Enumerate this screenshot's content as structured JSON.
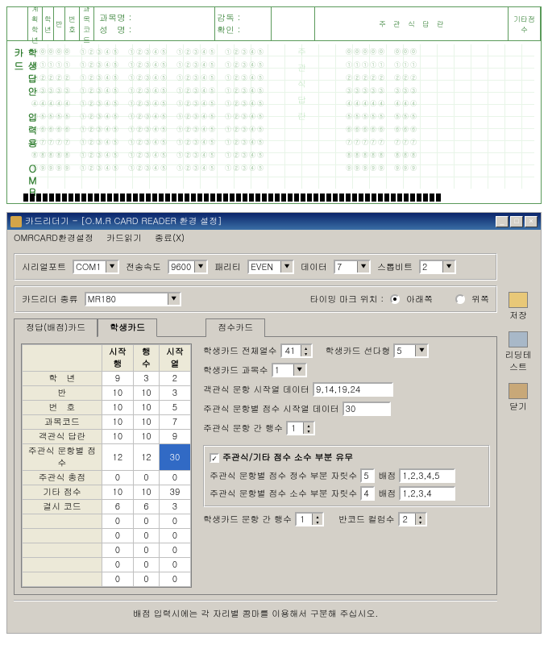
{
  "omr": {
    "side_label": "학생답안　입력용　ＯＭＲ카드",
    "watermark_lines": [
      "주",
      "관",
      "식",
      "답",
      "란"
    ],
    "header_cells": [
      "계획\n학년",
      "학\n년",
      "반",
      "번호",
      "과목\n코드"
    ],
    "header2": {
      "subject": "과목명 :",
      "supervisor": "감독 :",
      "name": "성　명 :",
      "confirm": "확인 :"
    },
    "top_right": "주　관　식　답　란",
    "top_right2": "기타점수"
  },
  "app": {
    "title": "카드리더기 - [O.M.R CARD READER 환경 설정]",
    "menu": [
      "OMRCARD환경설정",
      "카드읽기",
      "종료(X)"
    ],
    "tools": {
      "save": "저장",
      "test": "리딩테스트",
      "close": "닫기"
    },
    "conn": {
      "port_l": "시리얼포트",
      "port": "COM1",
      "baud_l": "전송속도",
      "baud": "9600",
      "parity_l": "패리티",
      "parity": "EVEN",
      "data_l": "데이터",
      "data": "7",
      "stop_l": "스톱비트",
      "stop": "2"
    },
    "reader": {
      "type_l": "카드리더 종류",
      "type": "MR180",
      "timing_l": "타이밍 마크 위치 :",
      "bottom": "아래쪽",
      "top": "위쪽"
    },
    "tabs": {
      "t1": "정답(배점)카드",
      "t2": "학생카드",
      "t3": "점수카드"
    },
    "grid": {
      "cols": [
        "",
        "시작행",
        "행 수",
        "시작열"
      ],
      "rows": [
        [
          "학　년",
          "9",
          "3",
          "2"
        ],
        [
          "반",
          "10",
          "10",
          "3"
        ],
        [
          "번　호",
          "10",
          "10",
          "5"
        ],
        [
          "과목코드",
          "10",
          "10",
          "7"
        ],
        [
          "객관식 답란",
          "10",
          "10",
          "9"
        ],
        [
          "주관식 문항별 점수",
          "12",
          "12",
          "30"
        ],
        [
          "주관식 총점",
          "0",
          "0",
          "0"
        ],
        [
          "기타 점수",
          "10",
          "10",
          "39"
        ],
        [
          "결시 코드",
          "6",
          "6",
          "3"
        ],
        [
          "",
          "0",
          "0",
          "0"
        ],
        [
          "",
          "0",
          "0",
          "0"
        ],
        [
          "",
          "0",
          "0",
          "0"
        ],
        [
          "",
          "0",
          "0",
          "0"
        ],
        [
          "",
          "0",
          "0",
          "0"
        ]
      ]
    },
    "right": {
      "total_cols_l": "학생카드 전체열수",
      "total_cols": "41",
      "sel_col_l": "학생카드 선다형",
      "sel_col": "5",
      "subj_cnt_l": "학생카드 과목수",
      "subj_cnt": "1",
      "obj_start_l": "객관식 문항 시작열 데이터",
      "obj_start": "9,14,19,24",
      "sub_score_start_l": "주관식 문항별 점수 시작열 데이터",
      "sub_score_start": "30",
      "sub_gap_l": "주관식 문항 간 행수",
      "sub_gap": "1",
      "decimal_chk": "주관식/기타 점수 소수 부분 유무",
      "int_digits_l": "주관식 문항별 점수 정수 부분 자릿수",
      "int_digits": "5",
      "int_dist_l": "배점",
      "int_dist": "1,2,3,4,5",
      "dec_digits_l": "주관식 문항별 점수 소수 부분 자릿수",
      "dec_digits": "4",
      "dec_dist_l": "배점",
      "dec_dist": "1,2,3,4",
      "item_gap_l": "학생카드 문항 간 행수",
      "item_gap": "1",
      "barcode_l": "반코드 컬럼수",
      "barcode": "2"
    },
    "footer": "배점 입력시에는 각 자리별 콤마를 이용해서 구분해 주십시오."
  }
}
